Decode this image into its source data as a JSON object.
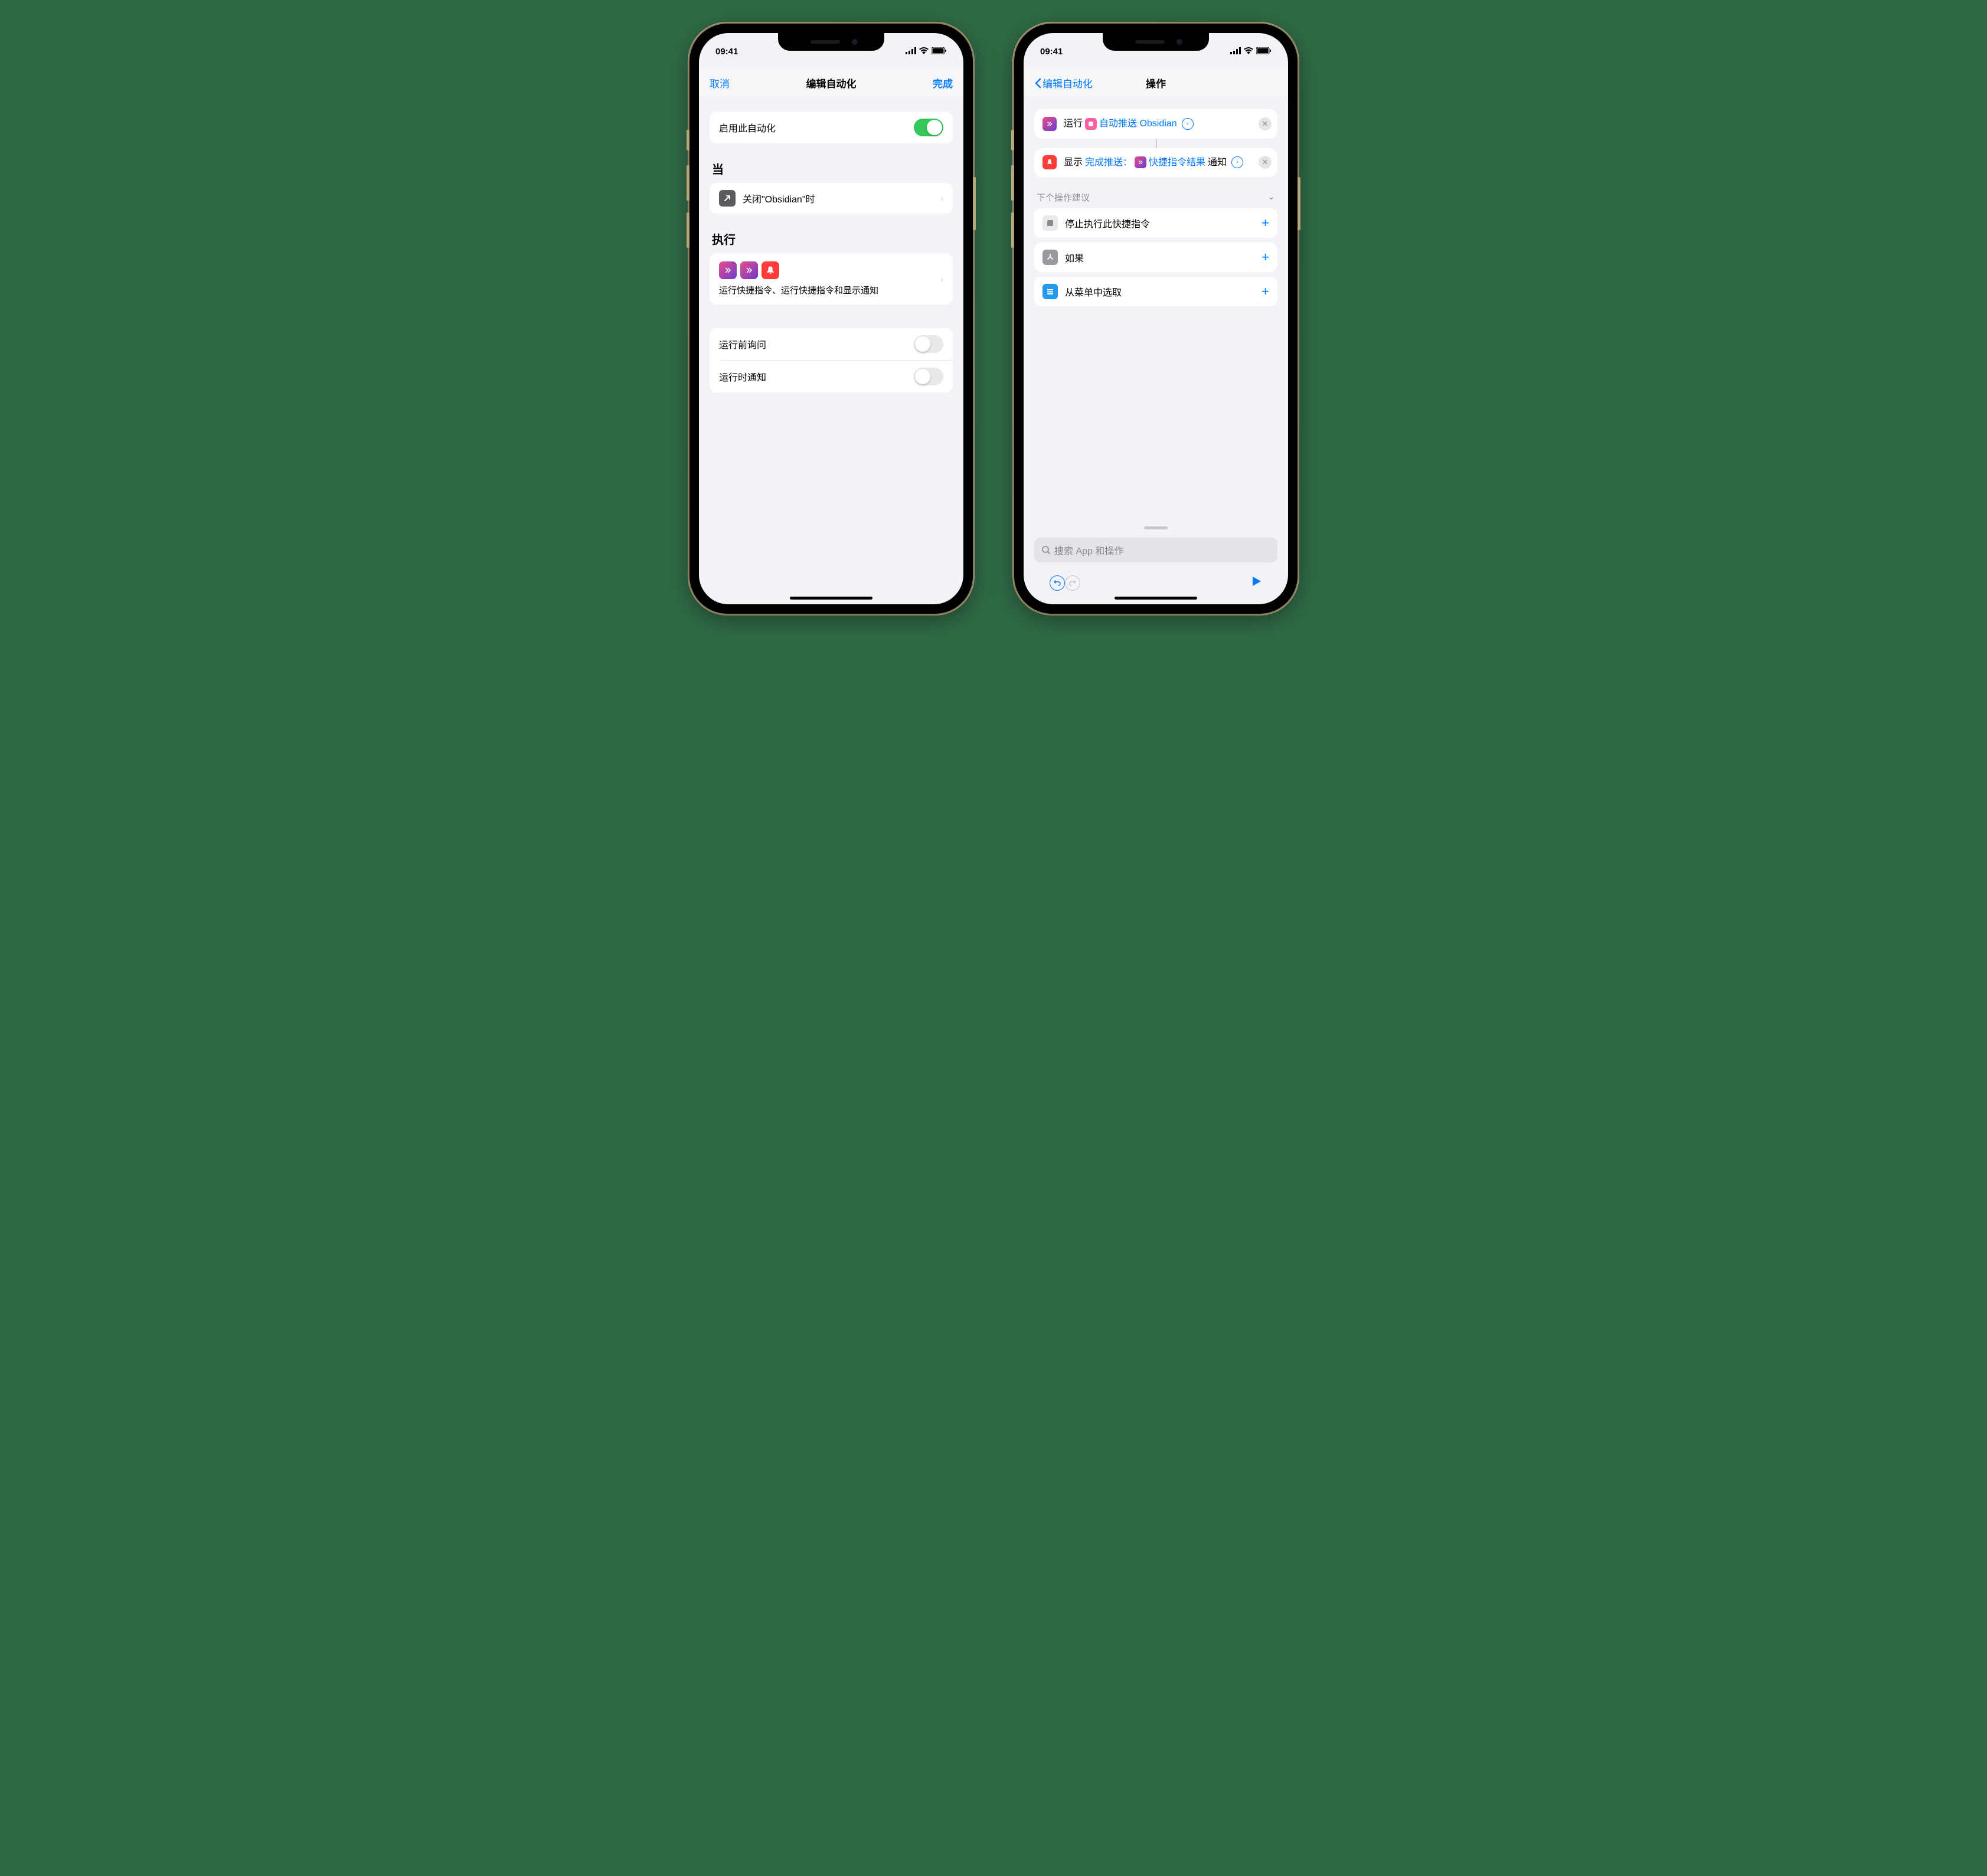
{
  "status": {
    "time": "09:41"
  },
  "left": {
    "nav": {
      "cancel": "取消",
      "title": "编辑自动化",
      "done": "完成"
    },
    "enable": {
      "label": "启用此自动化",
      "on": true
    },
    "when": {
      "header": "当",
      "row": "关闭\"Obsidian\"时"
    },
    "do": {
      "header": "执行",
      "desc": "运行快捷指令、运行快捷指令和显示通知"
    },
    "options": {
      "ask_before": "运行前询问",
      "notify": "运行时通知"
    }
  },
  "right": {
    "nav": {
      "back": "编辑自动化",
      "title": "操作"
    },
    "action1": {
      "verb": "运行",
      "shortcut_name": "自动推送 Obsidian"
    },
    "action2": {
      "verb": "显示",
      "text": "完成推送：",
      "result": "快捷指令结果",
      "suffix": "通知"
    },
    "suggestions": {
      "header": "下个操作建议",
      "items": [
        {
          "label": "停止执行此快捷指令",
          "icon_bg": "#e9e9ec"
        },
        {
          "label": "如果",
          "icon_bg": "#98989e"
        },
        {
          "label": "从菜单中选取",
          "icon_bg": "#2599eb"
        }
      ]
    },
    "search": {
      "placeholder": "搜索 App 和操作"
    }
  }
}
